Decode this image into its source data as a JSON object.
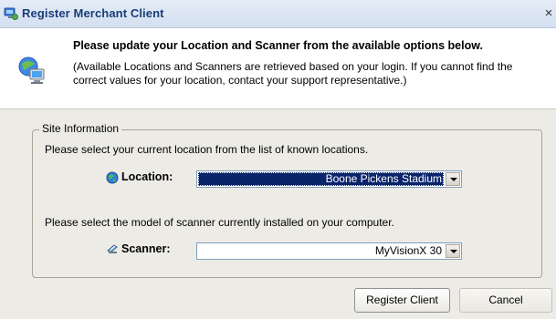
{
  "window": {
    "title": "Register Merchant Client",
    "close_glyph": "×"
  },
  "header": {
    "title": "Please update your Location and Scanner from the available options below.",
    "description": "(Available Locations and Scanners are retrieved based on your login. If you cannot find the correct values for your location, contact your support representative.)",
    "icon": "computer-network-icon"
  },
  "site_info": {
    "legend": "Site Information",
    "location_prompt": "Please select your current location from the list of known locations.",
    "location_label": "Location:",
    "location_icon": "globe-icon",
    "location_value": "Boone Pickens Stadium",
    "scanner_prompt": "Please select the model of scanner currently installed on your computer.",
    "scanner_label": "Scanner:",
    "scanner_icon": "scanner-icon",
    "scanner_value": "MyVisionX 30"
  },
  "buttons": {
    "register": "Register Client",
    "cancel": "Cancel"
  },
  "colors": {
    "selection": "#0a246a",
    "body_background": "#ecebe5",
    "title_text": "#1a3d78"
  }
}
